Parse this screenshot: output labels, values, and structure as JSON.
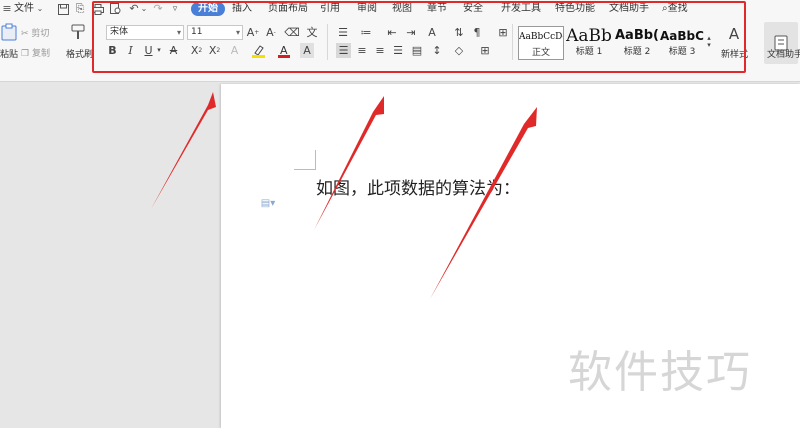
{
  "menu": {
    "file_label": "文件"
  },
  "tabs": [
    "开始",
    "插入",
    "页面布局",
    "引用",
    "审阅",
    "视图",
    "章节",
    "安全",
    "开发工具",
    "特色功能",
    "文档助手"
  ],
  "active_tab": "开始",
  "search_label": "查找",
  "clipboard": {
    "paste_label": "粘贴",
    "cut_label": "剪切",
    "copy_label": "复制",
    "format_painter_label": "格式刷"
  },
  "font": {
    "name": "宋体",
    "size": "11"
  },
  "styles": [
    {
      "sample": "AaBbCcDd",
      "name": "正文"
    },
    {
      "sample": "AaBb",
      "name": "标题 1"
    },
    {
      "sample": "AaBb(",
      "name": "标题 2"
    },
    {
      "sample": "AaBbC(",
      "name": "标题 3"
    }
  ],
  "new_style_label": "新样式",
  "doc_helper_label": "文档助手",
  "document": {
    "text": "如图，此项数据的算法为："
  },
  "watermark": "软件技巧",
  "colors": {
    "accent": "#4a7fd8",
    "annotation_red": "#e02a2a",
    "highlight": "#f5e100",
    "font_color": "#d22020"
  }
}
